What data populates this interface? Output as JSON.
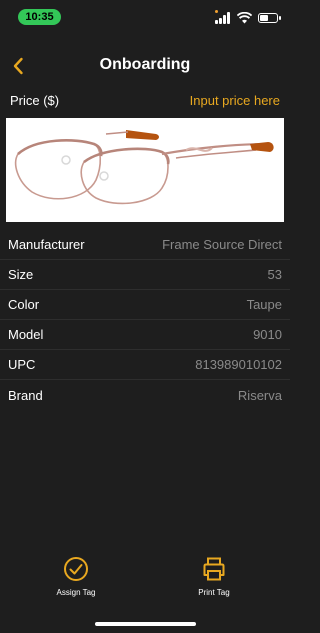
{
  "status_bar": {
    "time": "10:35",
    "time_pill_color": "#33c758"
  },
  "nav": {
    "title": "Onboarding",
    "back_icon": "chevron-left-icon",
    "accent": "#e8a820"
  },
  "price": {
    "label": "Price ($)",
    "placeholder": "Input price here"
  },
  "product": {
    "image_icon": "eyeglasses-image"
  },
  "details": {
    "rows": [
      {
        "label": "Manufacturer",
        "value": "Frame Source Direct"
      },
      {
        "label": "Size",
        "value": "53"
      },
      {
        "label": "Color",
        "value": "Taupe"
      },
      {
        "label": "Model",
        "value": "9010"
      },
      {
        "label": "UPC",
        "value": "813989010102"
      },
      {
        "label": "Brand",
        "value": "Riserva"
      }
    ]
  },
  "actions": {
    "assign_tag": {
      "label": "Assign Tag",
      "icon": "checkmark-circle-icon"
    },
    "print_tag": {
      "label": "Print Tag",
      "icon": "printer-icon"
    }
  }
}
